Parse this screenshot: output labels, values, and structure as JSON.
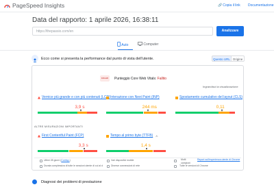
{
  "app": {
    "title": "PageSpeed Insights",
    "logo_icon": "pagespeed-logo-icon"
  },
  "topnav": {
    "copy_link": "Copia il link",
    "docs": "Documentazione"
  },
  "header": {
    "report_date": "Data del rapporto: 1 aprile 2026, 16:38:11",
    "url_value": "https://thepassio.com/en",
    "analyze_button": "Analizzare"
  },
  "tabs": [
    {
      "label": "Auto",
      "icon": "mobile-icon",
      "active": true
    },
    {
      "label": "Computer",
      "icon": "desktop-icon",
      "active": false
    }
  ],
  "section": {
    "heading": "Ecco come si presenta la performance dal punto di vista dell'utente.",
    "toggle": [
      "Questo URL",
      "Origine"
    ]
  },
  "assessment": {
    "badge": "FAILED",
    "label": "Punteggio Core Web Vitals:",
    "result": "Fallito",
    "expand": "Ingrandisci la visualizzazione"
  },
  "core_metrics": [
    {
      "label": "Vernice più grande e con più contenuti (LCP)",
      "value": "3,9 s",
      "status": "poor",
      "dist": [
        0.66,
        0.16,
        0.18
      ],
      "marker": 0.72
    },
    {
      "label": "Interazione con Next Paint (INP)",
      "value": "244 ms",
      "status": "needs-improvement",
      "dist": [
        0.62,
        0.24,
        0.14
      ],
      "marker": 0.7
    },
    {
      "label": "Spostamento cumulativo del layout (CLS)",
      "value": "0,11",
      "status": "needs-improvement",
      "dist": [
        0.72,
        0.18,
        0.1
      ],
      "marker": 0.78
    }
  ],
  "other_heading": "ALTRE MISURAZIONI IMPORTANTI",
  "other_metrics": [
    {
      "label": "First Contentful Paint (FCP)",
      "value": "3,3 s",
      "status": "poor",
      "dist": [
        0.52,
        0.24,
        0.24
      ],
      "marker": 0.78
    },
    {
      "label": "Tempo al primo byte (TTFB)",
      "value": "1,4 s",
      "status": "needs-improvement",
      "dist": [
        0.38,
        0.4,
        0.22
      ],
      "marker": 0.68
    }
  ],
  "footer": {
    "period_label": "Ultimi 28 giorni",
    "period_link": "Corrisp.",
    "devices": "Vari dispositivi mobile",
    "samples_lead": "Molti",
    "samples_text": "campioni",
    "samples_link": "Report sull'esperienza utente di Chrome",
    "visits": "Durata complessiva di tutte le sessioni utente di cui al dato tecnico sulle prestazioni",
    "network": "Diverse connessioni di rete",
    "chrome": "Tutte le versioni di Chrome"
  },
  "diagnostics": {
    "heading": "Diagnosi dei problemi di prestazione"
  },
  "colors": {
    "accent": "#1a73e8",
    "good": "#0cce6b",
    "average": "#ffa400",
    "poor": "#ff4e42"
  }
}
